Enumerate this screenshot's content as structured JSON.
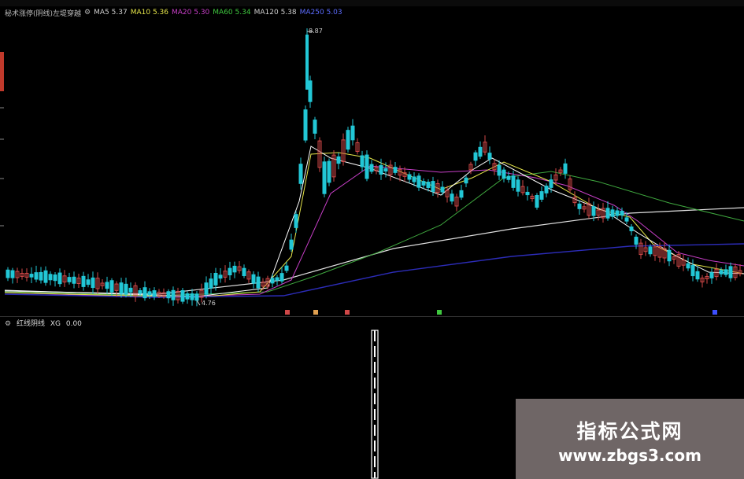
{
  "infobar": {
    "title": "秘术涨停(阴线)左堤穿越",
    "items": [
      {
        "label": "MA5",
        "value": "5.37",
        "color": "#cfcfcf"
      },
      {
        "label": "MA10",
        "value": "5.36",
        "color": "#e6e64a"
      },
      {
        "label": "MA20",
        "value": "5.30",
        "color": "#c83fc8"
      },
      {
        "label": "MA60",
        "value": "5.34",
        "color": "#3fc83f"
      },
      {
        "label": "MA120",
        "value": "5.38",
        "color": "#cfcfcf"
      },
      {
        "label": "MA250",
        "value": "5.03",
        "color": "#3d4fff"
      }
    ]
  },
  "main_chart": {
    "high_label": "8.87",
    "low_label": "4.76",
    "colors": {
      "up": "#d04848",
      "down": "#22c7d6",
      "ma5": "#ffffff",
      "ma10": "#e6e64a",
      "ma20": "#c83fc8",
      "ma60": "#3fa83f",
      "ma120": "#e0e0e0",
      "ma250": "#2c2cb8"
    }
  },
  "sub_chart": {
    "title": "红线阴线",
    "indicator": "XG",
    "value": "0.00"
  },
  "watermark": {
    "name": "指标公式网",
    "url": "www.zbgs3.com"
  }
}
